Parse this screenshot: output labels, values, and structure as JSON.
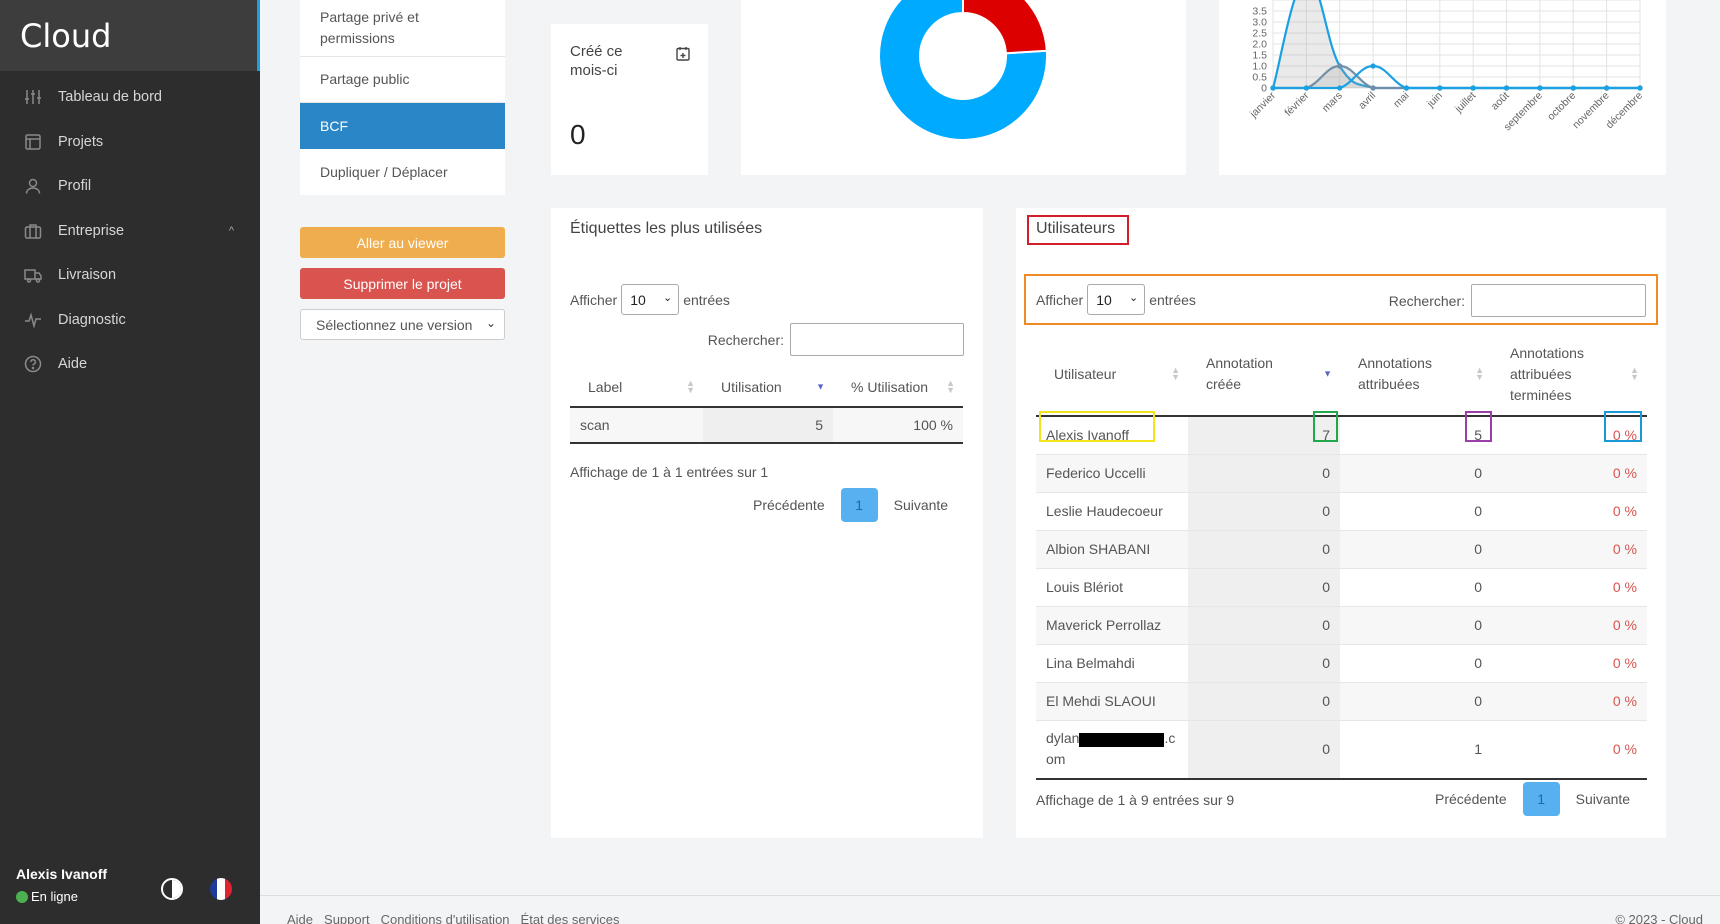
{
  "sidebar": {
    "brand": "Cloud",
    "items": [
      {
        "label": "Tableau de bord",
        "icon": "sliders-icon"
      },
      {
        "label": "Projets",
        "icon": "projects-icon"
      },
      {
        "label": "Profil",
        "icon": "user-icon"
      },
      {
        "label": "Entreprise",
        "icon": "briefcase-icon"
      },
      {
        "label": "Livraison",
        "icon": "truck-icon"
      },
      {
        "label": "Diagnostic",
        "icon": "pulse-icon"
      },
      {
        "label": "Aide",
        "icon": "help-icon"
      }
    ],
    "user_name": "Alexis Ivanoff",
    "status": "En ligne"
  },
  "project_menu": {
    "items": [
      "Partage privé et permissions",
      "Partage public",
      "BCF",
      "Dupliquer / Déplacer"
    ],
    "active": "BCF",
    "viewer_button": "Aller au viewer",
    "delete_button": "Supprimer le projet",
    "version_select": "Sélectionnez une version"
  },
  "stat": {
    "title": "Créé ce mois-ci",
    "value": "0"
  },
  "colors": {
    "accent": "#1ba0e2",
    "donut_blue": "#00aaff",
    "donut_red": "#dd0000",
    "line_blue": "#1ba0e2",
    "danger": "#d9534f",
    "warning": "#f0ad4e",
    "active_menu": "#2b86c7"
  },
  "chart_data": [
    {
      "type": "pie",
      "values": [
        76,
        24
      ],
      "colors": [
        "#00aaff",
        "#dd0000"
      ]
    },
    {
      "type": "line",
      "categories": [
        "janvier",
        "février",
        "mars",
        "avril",
        "mai",
        "juin",
        "juillet",
        "août",
        "septembre",
        "octobre",
        "novembre",
        "décembre"
      ],
      "yticks": [
        "0",
        "0.5",
        "1.0",
        "1.5",
        "2.0",
        "2.5",
        "3.0",
        "3.5"
      ],
      "ylim": [
        0,
        4
      ],
      "series": [
        {
          "values": [
            0,
            5,
            1,
            0,
            0,
            0,
            0,
            0,
            0,
            0,
            0,
            0
          ],
          "fill": true
        },
        {
          "values": [
            0,
            0,
            1,
            0,
            0,
            0,
            0,
            0,
            0,
            0,
            0,
            0
          ],
          "fill": true
        },
        {
          "values": [
            0,
            0,
            0,
            1,
            0,
            0,
            0,
            0,
            0,
            0,
            0,
            0
          ],
          "fill": false
        }
      ]
    }
  ],
  "tags": {
    "title": "Étiquettes les plus utilisées",
    "show": "Afficher",
    "entries": "entrées",
    "page_size": "10",
    "search": "Rechercher:",
    "headers": [
      "Label",
      "Utilisation",
      "% Utilisation"
    ],
    "rows": [
      {
        "label": "scan",
        "usage": "5",
        "percent": "100 %"
      }
    ],
    "info": "Affichage de 1 à 1 entrées sur 1",
    "prev": "Précédente",
    "page": "1",
    "next": "Suivante"
  },
  "users": {
    "title": "Utilisateurs",
    "show": "Afficher",
    "entries": "entrées",
    "page_size": "10",
    "search": "Rechercher:",
    "headers": [
      "Utilisateur",
      "Annotation créée",
      "Annotations attribuées",
      "Annotations attribuées terminées"
    ],
    "rows": [
      {
        "name": "Alexis Ivanoff",
        "created": "7",
        "assigned": "5",
        "done": "0 %"
      },
      {
        "name": "Federico Uccelli",
        "created": "0",
        "assigned": "0",
        "done": "0 %"
      },
      {
        "name": "Leslie Haudecoeur",
        "created": "0",
        "assigned": "0",
        "done": "0 %"
      },
      {
        "name": "Albion SHABANI",
        "created": "0",
        "assigned": "0",
        "done": "0 %"
      },
      {
        "name": "Louis Blériot",
        "created": "0",
        "assigned": "0",
        "done": "0 %"
      },
      {
        "name": "Maverick Perrollaz",
        "created": "0",
        "assigned": "0",
        "done": "0 %"
      },
      {
        "name": "Lina Belmahdi",
        "created": "0",
        "assigned": "0",
        "done": "0 %"
      },
      {
        "name": "El Mehdi SLAOUI",
        "created": "0",
        "assigned": "0",
        "done": "0 %"
      },
      {
        "name_prefix": "dylan",
        "name_suffix": ".c",
        "name_tail": "om",
        "created": "0",
        "assigned": "1",
        "done": "0 %"
      }
    ],
    "info": "Affichage de 1 à 9 entrées sur 9",
    "prev": "Précédente",
    "page": "1",
    "next": "Suivante"
  },
  "footer": {
    "links": [
      "Aide",
      "Support",
      "Conditions d'utilisation",
      "État des services"
    ],
    "copyright": "© 2023 - Cloud"
  }
}
